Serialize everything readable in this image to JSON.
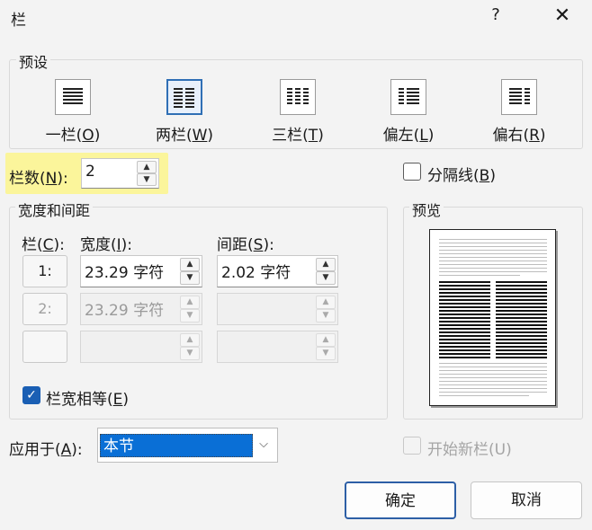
{
  "window": {
    "title": "栏",
    "help_label": "?",
    "close_label": "✕"
  },
  "presets": {
    "group_label": "预设",
    "items": [
      {
        "label": "一栏(",
        "key": "O",
        "suffix": ")",
        "icon": "one-column-icon"
      },
      {
        "label": "两栏(",
        "key": "W",
        "suffix": ")",
        "icon": "two-columns-icon",
        "selected": true
      },
      {
        "label": "三栏(",
        "key": "T",
        "suffix": ")",
        "icon": "three-columns-icon"
      },
      {
        "label": "偏左(",
        "key": "L",
        "suffix": ")",
        "icon": "left-column-icon"
      },
      {
        "label": "偏右(",
        "key": "R",
        "suffix": ")",
        "icon": "right-column-icon"
      }
    ]
  },
  "columns_count": {
    "label_pre": "栏数(",
    "label_key": "N",
    "label_post": "):",
    "value": "2"
  },
  "separator": {
    "label_pre": "分隔线(",
    "label_key": "B",
    "label_post": ")",
    "checked": false
  },
  "width_spacing": {
    "group_label": "宽度和间距",
    "col_header_pre": "栏(",
    "col_header_key": "C",
    "col_header_post": "):",
    "width_header_pre": "宽度(",
    "width_header_key": "I",
    "width_header_post": "):",
    "spacing_header_pre": "间距(",
    "spacing_header_key": "S",
    "spacing_header_post": "):",
    "rows": [
      {
        "col": "1:",
        "width": "23.29 字符",
        "spacing": "2.02 字符",
        "enabled": true
      },
      {
        "col": "2:",
        "width": "23.29 字符",
        "spacing": "",
        "enabled": false
      },
      {
        "col": "",
        "width": "",
        "spacing": "",
        "enabled": false
      }
    ],
    "equal_width": {
      "label_pre": "栏宽相等(",
      "label_key": "E",
      "label_post": ")",
      "checked": true
    }
  },
  "preview": {
    "group_label": "预览"
  },
  "apply_to": {
    "label_pre": "应用于(",
    "label_key": "A",
    "label_post": "):",
    "value": "本节"
  },
  "new_column": {
    "label": "开始新栏(U)",
    "checked": false
  },
  "buttons": {
    "ok": "确定",
    "cancel": "取消"
  },
  "colors": {
    "accent": "#1a5fb4",
    "highlight": "#fbf59b",
    "selection": "#0a6fd6"
  }
}
